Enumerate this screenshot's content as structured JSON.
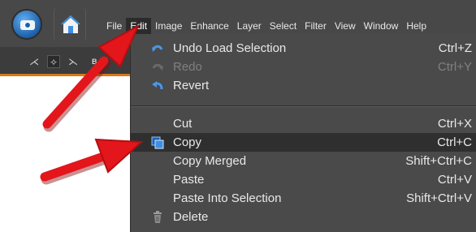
{
  "menubar": {
    "items": [
      "File",
      "Edit",
      "Image",
      "Enhance",
      "Layer",
      "Select",
      "Filter",
      "View",
      "Window",
      "Help"
    ],
    "active_item": "Edit"
  },
  "toolbar": {
    "partial_label": "B"
  },
  "edit_menu": {
    "items": [
      {
        "label": "Undo Load Selection",
        "shortcut": "Ctrl+Z",
        "icon": "undo-icon",
        "state": "enabled"
      },
      {
        "label": "Redo",
        "shortcut": "Ctrl+Y",
        "icon": "redo-icon",
        "state": "disabled"
      },
      {
        "label": "Revert",
        "shortcut": "",
        "icon": "revert-icon",
        "state": "enabled"
      },
      {
        "label": "Cut",
        "shortcut": "Ctrl+X",
        "icon": "",
        "state": "enabled"
      },
      {
        "label": "Copy",
        "shortcut": "Ctrl+C",
        "icon": "copy-icon",
        "state": "highlighted"
      },
      {
        "label": "Copy Merged",
        "shortcut": "Shift+Ctrl+C",
        "icon": "",
        "state": "enabled"
      },
      {
        "label": "Paste",
        "shortcut": "Ctrl+V",
        "icon": "",
        "state": "enabled"
      },
      {
        "label": "Paste Into Selection",
        "shortcut": "Shift+Ctrl+V",
        "icon": "",
        "state": "enabled"
      },
      {
        "label": "Delete",
        "shortcut": "",
        "icon": "trash-icon",
        "state": "enabled"
      }
    ]
  },
  "colors": {
    "menubar_bg": "#484848",
    "menu_bg": "#4a4a4a",
    "highlight_bg": "#2f2f2f",
    "toolbar_accent": "#d77a18",
    "arrow_red": "#e3161b",
    "icon_blue": "#2f7fd8"
  },
  "annotations": {
    "arrow_count": 2,
    "arrow_targets": [
      "Edit",
      "Copy"
    ]
  }
}
